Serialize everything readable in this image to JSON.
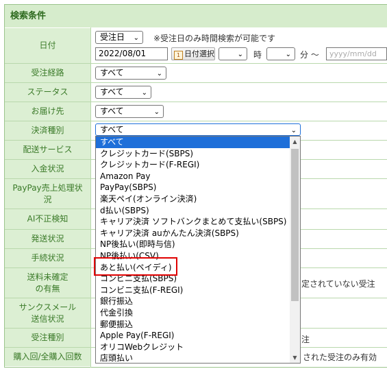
{
  "section_title": "検索条件",
  "labels": {
    "date": "日付",
    "route": "受注経路",
    "status": "ステータス",
    "delivery": "お届け先",
    "payment": "決済種別",
    "delivery_service": "配送サービス",
    "deposit": "入金状況",
    "paypay": "PayPay売上処理状況",
    "ai_fraud": "AI不正検知",
    "shipping": "発送状況",
    "procedure": "手続状況",
    "shipping_unconfirmed": "送料未確定の有無",
    "thanks_mail": "サンクスメール送信状況",
    "order_type": "受注種別",
    "purchase_count": "購入回/全購入回数"
  },
  "date_row": {
    "type_select": "受注日",
    "note": "※受注日のみ時間検索が可能です",
    "date_value": "2022/08/01",
    "calendar_button": "日付選択",
    "hour_unit": "時",
    "minute_unit": "分 ～",
    "end_placeholder": "yyyy/mm/dd"
  },
  "selects": {
    "route": "すべて",
    "status": "すべて",
    "delivery": "すべて",
    "payment": "すべて"
  },
  "partial_texts": {
    "shipping_unconfirmed_tail": "定されていない受注",
    "order_type_tail": "注",
    "purchase_tail": "された受注のみ有効"
  },
  "payment_options": [
    "すべて",
    "クレジットカード(SBPS)",
    "クレジットカード(F-REGI)",
    "Amazon Pay",
    "PayPay(SBPS)",
    "楽天ペイ(オンライン決済)",
    "d払い(SBPS)",
    "キャリア決済 ソフトバンクまとめて支払い(SBPS)",
    "キャリア決済 auかんたん決済(SBPS)",
    "NP後払い(即時与信)",
    "NP後払い(CSV)",
    "あと払い(ペイディ)",
    "コンビニ支払(SBPS)",
    "コンビニ支払(F-REGI)",
    "銀行振込",
    "代金引換",
    "郵便振込",
    "Apple Pay(F-REGI)",
    "オリコWebクレジット",
    "店頭払い"
  ],
  "colors": {
    "highlight": "#1e6fd9",
    "annotation": "#e00000",
    "label_bg": "#dcefd3"
  }
}
